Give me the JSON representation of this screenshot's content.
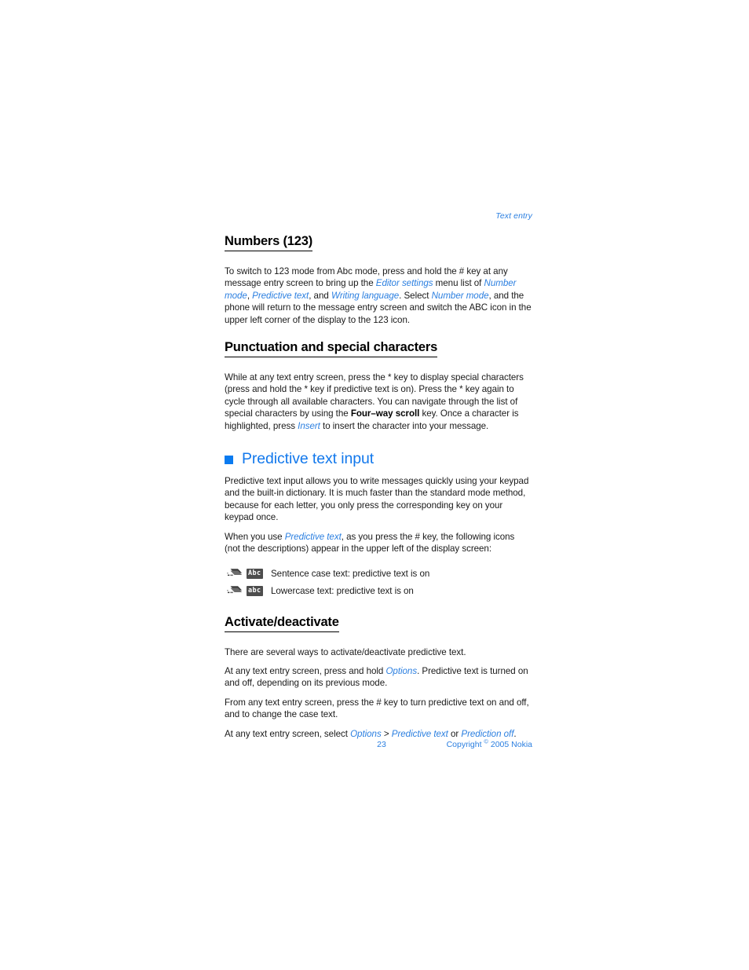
{
  "header": {
    "running_title": "Text entry"
  },
  "sections": [
    {
      "heading": "Numbers (123)",
      "paragraphs": [
        {
          "runs": [
            {
              "t": "To switch to 123 mode from Abc mode, press and hold the # key at any message entry screen to bring up the ",
              "s": "n"
            },
            {
              "t": "Editor settings",
              "s": "i"
            },
            {
              "t": " menu list of ",
              "s": "n"
            },
            {
              "t": "Number mode",
              "s": "i"
            },
            {
              "t": ", ",
              "s": "n"
            },
            {
              "t": "Predictive text",
              "s": "i"
            },
            {
              "t": ", and ",
              "s": "n"
            },
            {
              "t": "Writing language",
              "s": "i"
            },
            {
              "t": ". Select ",
              "s": "n"
            },
            {
              "t": "Number mode",
              "s": "i"
            },
            {
              "t": ", and the phone will return to the message entry screen and switch the ABC icon in the upper left corner of the display to the 123 icon.",
              "s": "n"
            }
          ]
        }
      ]
    },
    {
      "heading": "Punctuation and special characters",
      "paragraphs": [
        {
          "runs": [
            {
              "t": "While at any text entry screen, press the * key to display special characters (press and hold the * key if predictive text is on). Press the * key again to cycle through all available characters. You can navigate through the list of special characters by using the ",
              "s": "n"
            },
            {
              "t": "Four–way scroll",
              "s": "b"
            },
            {
              "t": " key. Once a character is highlighted, press ",
              "s": "n"
            },
            {
              "t": "Insert",
              "s": "i"
            },
            {
              "t": " to insert the character into your message.",
              "s": "n"
            }
          ]
        }
      ]
    }
  ],
  "chapter": {
    "title": "Predictive text input",
    "bullet_color": "#0a7bf0",
    "paragraphs": [
      {
        "runs": [
          {
            "t": "Predictive text input allows you to write messages quickly using your keypad and the built-in dictionary. It is much faster than the standard mode method, because for each letter, you only press the corresponding key on your keypad once.",
            "s": "n"
          }
        ]
      },
      {
        "runs": [
          {
            "t": "When you use ",
            "s": "n"
          },
          {
            "t": "Predictive text",
            "s": "i"
          },
          {
            "t": ", as you press the # key, the following icons (not the descriptions) appear in the upper left of the display screen:",
            "s": "n"
          }
        ]
      }
    ]
  },
  "icon_legend": [
    {
      "icon_name": "predictive-text-swoosh-icon",
      "badge": "Abc",
      "description": "Sentence case text: predictive text is on"
    },
    {
      "icon_name": "predictive-text-swoosh-icon",
      "badge": "abc",
      "description": "Lowercase text: predictive text is on"
    }
  ],
  "activate_section": {
    "heading": "Activate/deactivate",
    "paragraphs": [
      {
        "runs": [
          {
            "t": "There are several ways to activate/deactivate predictive text.",
            "s": "n"
          }
        ]
      },
      {
        "runs": [
          {
            "t": "At any text entry screen, press and hold ",
            "s": "n"
          },
          {
            "t": "Options",
            "s": "i"
          },
          {
            "t": ". Predictive text is turned on and off, depending on its previous mode.",
            "s": "n"
          }
        ]
      },
      {
        "runs": [
          {
            "t": "From any text entry screen, press the # key to turn predictive text on and off, and to change the case text.",
            "s": "n"
          }
        ]
      },
      {
        "runs": [
          {
            "t": "At any text entry screen, select ",
            "s": "n"
          },
          {
            "t": "Options",
            "s": "i"
          },
          {
            "t": " > ",
            "s": "n"
          },
          {
            "t": "Predictive text",
            "s": "i"
          },
          {
            "t": " or ",
            "s": "n"
          },
          {
            "t": "Prediction off",
            "s": "i"
          },
          {
            "t": ".",
            "s": "n"
          }
        ]
      }
    ]
  },
  "footer": {
    "page_number": "23",
    "copyright_prefix": "Copyright ",
    "copyright_symbol": "©",
    "copyright_suffix": " 2005 Nokia"
  },
  "colors": {
    "link_blue": "#2b7fe0",
    "heading_blue": "#1278ec",
    "body_black": "#1a1a1a",
    "badge_gray": "#4d4d4d"
  }
}
